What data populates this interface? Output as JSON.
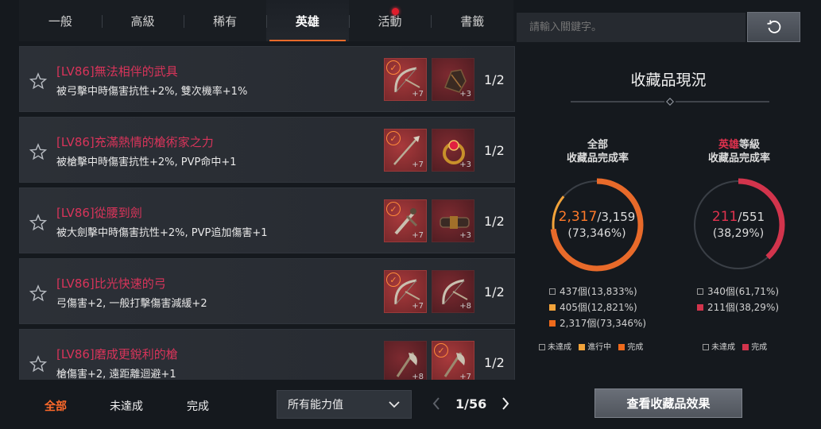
{
  "tabs": [
    {
      "label": "一般",
      "active": false
    },
    {
      "label": "高級",
      "active": false
    },
    {
      "label": "稀有",
      "active": false
    },
    {
      "label": "英雄",
      "active": true
    },
    {
      "label": "活動",
      "active": false,
      "notification": true
    },
    {
      "label": "書籤",
      "active": false
    }
  ],
  "search": {
    "placeholder": "請輸入關鍵字。"
  },
  "collections": [
    {
      "title": "[LV86]無法相伴的武具",
      "desc": "被弓擊中時傷害抗性+2%, 雙次機率+1%",
      "count": "1/2",
      "items": [
        {
          "icon": "bow-icon",
          "plus": "+7",
          "collected": true
        },
        {
          "icon": "gauntlet-icon",
          "plus": "+3",
          "collected": false
        }
      ]
    },
    {
      "title": "[LV86]充滿熱情的槍術家之力",
      "desc": "被槍擊中時傷害抗性+2%, PVP命中+1",
      "count": "1/2",
      "items": [
        {
          "icon": "spear-icon",
          "plus": "+7",
          "collected": true
        },
        {
          "icon": "ring-icon",
          "plus": "+3",
          "collected": false
        }
      ]
    },
    {
      "title": "[LV86]從腰到劍",
      "desc": "被大劍擊中時傷害抗性+2%, PVP追加傷害+1",
      "count": "1/2",
      "items": [
        {
          "icon": "greatsword-icon",
          "plus": "+7",
          "collected": true
        },
        {
          "icon": "belt-icon",
          "plus": "+3",
          "collected": false
        }
      ]
    },
    {
      "title": "[LV86]比光快速的弓",
      "desc": "弓傷害+2, 一般打擊傷害減緩+2",
      "count": "1/2",
      "items": [
        {
          "icon": "bow-icon",
          "plus": "+7",
          "collected": true
        },
        {
          "icon": "bow-icon",
          "plus": "+8",
          "collected": false
        }
      ]
    },
    {
      "title": "[LV86]磨成更銳利的槍",
      "desc": "槍傷害+2, 遠距離迴避+1",
      "count": "1/2",
      "items": [
        {
          "icon": "axe-icon",
          "plus": "+8",
          "collected": false
        },
        {
          "icon": "axe-icon",
          "plus": "+7",
          "collected": true
        }
      ]
    }
  ],
  "filters": {
    "all": "全部",
    "incomplete": "未達成",
    "complete": "完成"
  },
  "ability_select": {
    "value": "所有能力值"
  },
  "pager": {
    "text": "1/56"
  },
  "panel": {
    "title": "收藏品現況",
    "total": {
      "head_line1": "全部",
      "head_line2": "收藏品完成率",
      "done": "2,317",
      "sep": "/",
      "total": "3,159",
      "percent": "(73,346%)",
      "ratio_done": 0.7335,
      "ratio_progress": 0.1282,
      "legend": [
        {
          "type": "empty",
          "text": "437個(13,833%)"
        },
        {
          "type": "progress",
          "text": "405個(12,821%)"
        },
        {
          "type": "done",
          "text": "2,317個(73,346%)"
        }
      ],
      "keys": {
        "incomplete": "未達成",
        "progress": "進行中",
        "done": "完成"
      }
    },
    "hero": {
      "head_hl": "英雄",
      "head_rest": "等級",
      "head_line2": "收藏品完成率",
      "done": "211",
      "sep": "/",
      "total": "551",
      "percent": "(38,29%)",
      "ratio_done": 0.3829,
      "legend": [
        {
          "type": "empty",
          "text": "340個(61,71%)"
        },
        {
          "type": "done",
          "text": "211個(38,29%)"
        }
      ],
      "keys": {
        "incomplete": "未達成",
        "done": "完成"
      }
    },
    "effect_button": "查看收藏品效果"
  },
  "colors": {
    "accent": "#e86a2a",
    "title_red": "#d8345a",
    "progress": "#f2a33a",
    "hero_red": "#d2344c"
  }
}
